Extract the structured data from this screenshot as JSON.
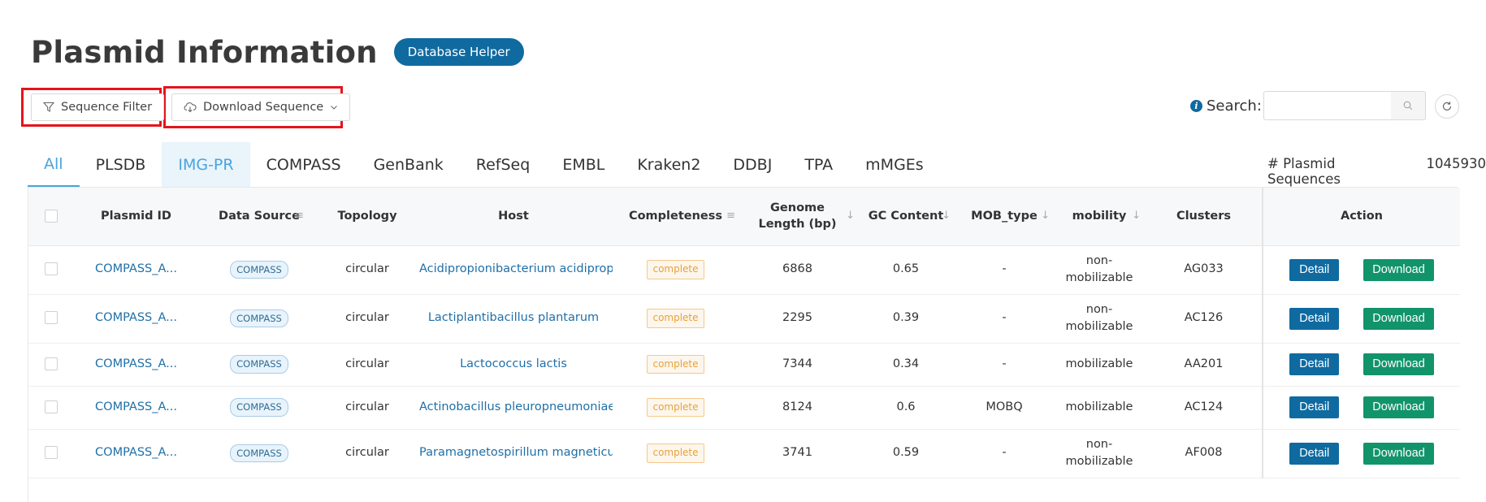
{
  "header": {
    "title": "Plasmid Information",
    "helper_label": "Database Helper"
  },
  "toolbar": {
    "filter_label": "Sequence Filter",
    "download_label": "Download Sequence"
  },
  "search": {
    "label": "Search:",
    "value": "",
    "placeholder": ""
  },
  "tabs": [
    {
      "label": "All"
    },
    {
      "label": "PLSDB"
    },
    {
      "label": "IMG-PR"
    },
    {
      "label": "COMPASS"
    },
    {
      "label": "GenBank"
    },
    {
      "label": "RefSeq"
    },
    {
      "label": "EMBL"
    },
    {
      "label": "Kraken2"
    },
    {
      "label": "DDBJ"
    },
    {
      "label": "TPA"
    },
    {
      "label": "mMGEs"
    }
  ],
  "sequence_count": {
    "label": "# Plasmid Sequences",
    "value": "1045930"
  },
  "table": {
    "columns": {
      "plasmid_id": "Plasmid ID",
      "data_source": "Data Source",
      "topology": "Topology",
      "host": "Host",
      "completeness": "Completeness",
      "genome_length_1": "Genome",
      "genome_length_2": "Length (bp)",
      "gc": "GC Content",
      "mob": "MOB_type",
      "mobility": "mobility",
      "clusters": "Clusters",
      "action": "Action"
    },
    "detail_label": "Detail",
    "download_label": "Download",
    "rows": [
      {
        "id": "COMPASS_A...",
        "source": "COMPASS",
        "topology": "circular",
        "host": "Acidipropionibacterium acidipropi",
        "completeness": "complete",
        "length": "6868",
        "gc": "0.65",
        "mob": "-",
        "mobility_1": "non-",
        "mobility_2": "mobilizable",
        "cluster": "AG033"
      },
      {
        "id": "COMPASS_A...",
        "source": "COMPASS",
        "topology": "circular",
        "host": "Lactiplantibacillus plantarum",
        "completeness": "complete",
        "length": "2295",
        "gc": "0.39",
        "mob": "-",
        "mobility_1": "non-",
        "mobility_2": "mobilizable",
        "cluster": "AC126"
      },
      {
        "id": "COMPASS_A...",
        "source": "COMPASS",
        "topology": "circular",
        "host": "Lactococcus lactis",
        "completeness": "complete",
        "length": "7344",
        "gc": "0.34",
        "mob": "-",
        "mobility_1": "mobilizable",
        "mobility_2": "",
        "cluster": "AA201"
      },
      {
        "id": "COMPASS_A...",
        "source": "COMPASS",
        "topology": "circular",
        "host": "Actinobacillus pleuropneumoniae",
        "completeness": "complete",
        "length": "8124",
        "gc": "0.6",
        "mob": "MOBQ",
        "mobility_1": "mobilizable",
        "mobility_2": "",
        "cluster": "AC124"
      },
      {
        "id": "COMPASS_A...",
        "source": "COMPASS",
        "topology": "circular",
        "host": "Paramagnetospirillum magneticun",
        "completeness": "complete",
        "length": "3741",
        "gc": "0.59",
        "mob": "-",
        "mobility_1": "non-",
        "mobility_2": "mobilizable",
        "cluster": "AF008"
      }
    ]
  }
}
